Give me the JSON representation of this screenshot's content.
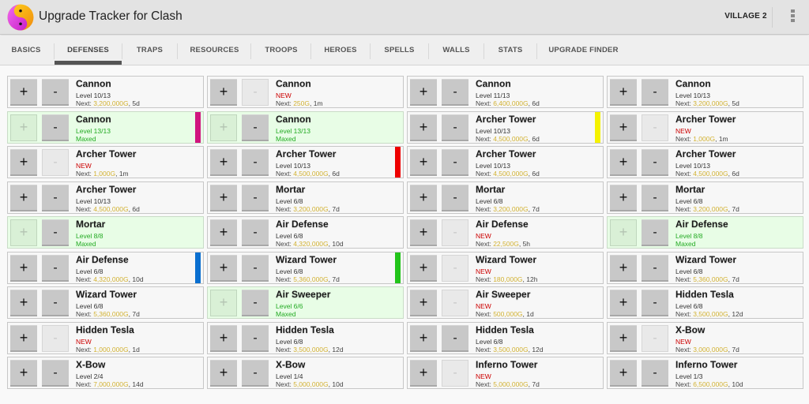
{
  "app": {
    "title": "Upgrade Tracker for Clash",
    "icon": "yin-yang-icon",
    "village_button": "VILLAGE 2",
    "overflow_icon": "overflow-menu-icon"
  },
  "tabs": [
    {
      "label": "BASICS",
      "active": false
    },
    {
      "label": "DEFENSES",
      "active": true
    },
    {
      "label": "TRAPS",
      "active": false
    },
    {
      "label": "RESOURCES",
      "active": false
    },
    {
      "label": "TROOPS",
      "active": false
    },
    {
      "label": "HEROES",
      "active": false
    },
    {
      "label": "SPELLS",
      "active": false
    },
    {
      "label": "WALLS",
      "active": false
    },
    {
      "label": "STATS",
      "active": false
    },
    {
      "label": "UPGRADE FINDER",
      "active": false
    }
  ],
  "labels": {
    "plus": "+",
    "minus": "-",
    "next_prefix": "Next: ",
    "sep": ", "
  },
  "columns": [
    [
      {
        "name": "Cannon",
        "status": "level",
        "level": "Level 10/13",
        "cost": "3,200,000G",
        "time": "5d",
        "plus_enabled": true,
        "minus_enabled": true,
        "marker": null
      },
      {
        "name": "Cannon",
        "status": "maxed",
        "level": "Level 13/13",
        "maxed": "Maxed",
        "plus_enabled": false,
        "minus_enabled": true,
        "marker": "#d0157e"
      },
      {
        "name": "Archer Tower",
        "status": "new",
        "level": "NEW",
        "cost": "1,000G",
        "time": "1m",
        "plus_enabled": true,
        "minus_enabled": false,
        "marker": null
      },
      {
        "name": "Archer Tower",
        "status": "level",
        "level": "Level 10/13",
        "cost": "4,500,000G",
        "time": "6d",
        "plus_enabled": true,
        "minus_enabled": true,
        "marker": null
      },
      {
        "name": "Mortar",
        "status": "maxed",
        "level": "Level 8/8",
        "maxed": "Maxed",
        "plus_enabled": false,
        "minus_enabled": true,
        "marker": null
      },
      {
        "name": "Air Defense",
        "status": "level",
        "level": "Level 6/8",
        "cost": "4,320,000G",
        "time": "10d",
        "plus_enabled": true,
        "minus_enabled": true,
        "marker": "#0a6fd0"
      },
      {
        "name": "Wizard Tower",
        "status": "level",
        "level": "Level 6/8",
        "cost": "5,360,000G",
        "time": "7d",
        "plus_enabled": true,
        "minus_enabled": true,
        "marker": null
      },
      {
        "name": "Hidden Tesla",
        "status": "new",
        "level": "NEW",
        "cost": "1,000,000G",
        "time": "1d",
        "plus_enabled": true,
        "minus_enabled": false,
        "marker": null
      },
      {
        "name": "X-Bow",
        "status": "level",
        "level": "Level 2/4",
        "cost": "7,000,000G",
        "time": "14d",
        "plus_enabled": true,
        "minus_enabled": true,
        "marker": null
      }
    ],
    [
      {
        "name": "Cannon",
        "status": "new",
        "level": "NEW",
        "cost": "250G",
        "time": "1m",
        "plus_enabled": true,
        "minus_enabled": false,
        "marker": null
      },
      {
        "name": "Cannon",
        "status": "maxed",
        "level": "Level 13/13",
        "maxed": "Maxed",
        "plus_enabled": false,
        "minus_enabled": true,
        "marker": null
      },
      {
        "name": "Archer Tower",
        "status": "level",
        "level": "Level 10/13",
        "cost": "4,500,000G",
        "time": "6d",
        "plus_enabled": true,
        "minus_enabled": true,
        "marker": "#ee0000"
      },
      {
        "name": "Mortar",
        "status": "level",
        "level": "Level 6/8",
        "cost": "3,200,000G",
        "time": "7d",
        "plus_enabled": true,
        "minus_enabled": true,
        "marker": null
      },
      {
        "name": "Air Defense",
        "status": "level",
        "level": "Level 6/8",
        "cost": "4,320,000G",
        "time": "10d",
        "plus_enabled": true,
        "minus_enabled": true,
        "marker": null
      },
      {
        "name": "Wizard Tower",
        "status": "level",
        "level": "Level 6/8",
        "cost": "5,360,000G",
        "time": "7d",
        "plus_enabled": true,
        "minus_enabled": true,
        "marker": "#22c41a"
      },
      {
        "name": "Air Sweeper",
        "status": "maxed",
        "level": "Level 6/6",
        "maxed": "Maxed",
        "plus_enabled": false,
        "minus_enabled": true,
        "marker": null
      },
      {
        "name": "Hidden Tesla",
        "status": "level",
        "level": "Level 6/8",
        "cost": "3,500,000G",
        "time": "12d",
        "plus_enabled": true,
        "minus_enabled": true,
        "marker": null
      },
      {
        "name": "X-Bow",
        "status": "level",
        "level": "Level 1/4",
        "cost": "5,000,000G",
        "time": "10d",
        "plus_enabled": true,
        "minus_enabled": true,
        "marker": null
      }
    ],
    [
      {
        "name": "Cannon",
        "status": "level",
        "level": "Level 11/13",
        "cost": "6,400,000G",
        "time": "6d",
        "plus_enabled": true,
        "minus_enabled": true,
        "marker": null
      },
      {
        "name": "Archer Tower",
        "status": "level",
        "level": "Level 10/13",
        "cost": "4,500,000G",
        "time": "6d",
        "plus_enabled": true,
        "minus_enabled": true,
        "marker": "#f5f200"
      },
      {
        "name": "Archer Tower",
        "status": "level",
        "level": "Level 10/13",
        "cost": "4,500,000G",
        "time": "6d",
        "plus_enabled": true,
        "minus_enabled": true,
        "marker": null
      },
      {
        "name": "Mortar",
        "status": "level",
        "level": "Level 6/8",
        "cost": "3,200,000G",
        "time": "7d",
        "plus_enabled": true,
        "minus_enabled": true,
        "marker": null
      },
      {
        "name": "Air Defense",
        "status": "new",
        "level": "NEW",
        "cost": "22,500G",
        "time": "5h",
        "plus_enabled": true,
        "minus_enabled": false,
        "marker": null
      },
      {
        "name": "Wizard Tower",
        "status": "new",
        "level": "NEW",
        "cost": "180,000G",
        "time": "12h",
        "plus_enabled": true,
        "minus_enabled": false,
        "marker": null
      },
      {
        "name": "Air Sweeper",
        "status": "new",
        "level": "NEW",
        "cost": "500,000G",
        "time": "1d",
        "plus_enabled": true,
        "minus_enabled": false,
        "marker": null
      },
      {
        "name": "Hidden Tesla",
        "status": "level",
        "level": "Level 6/8",
        "cost": "3,500,000G",
        "time": "12d",
        "plus_enabled": true,
        "minus_enabled": true,
        "marker": null
      },
      {
        "name": "Inferno Tower",
        "status": "new",
        "level": "NEW",
        "cost": "5,000,000G",
        "time": "7d",
        "plus_enabled": true,
        "minus_enabled": false,
        "marker": null
      }
    ],
    [
      {
        "name": "Cannon",
        "status": "level",
        "level": "Level 10/13",
        "cost": "3,200,000G",
        "time": "5d",
        "plus_enabled": true,
        "minus_enabled": true,
        "marker": null
      },
      {
        "name": "Archer Tower",
        "status": "new",
        "level": "NEW",
        "cost": "1,000G",
        "time": "1m",
        "plus_enabled": true,
        "minus_enabled": false,
        "marker": null
      },
      {
        "name": "Archer Tower",
        "status": "level",
        "level": "Level 10/13",
        "cost": "4,500,000G",
        "time": "6d",
        "plus_enabled": true,
        "minus_enabled": true,
        "marker": null
      },
      {
        "name": "Mortar",
        "status": "level",
        "level": "Level 6/8",
        "cost": "3,200,000G",
        "time": "7d",
        "plus_enabled": true,
        "minus_enabled": true,
        "marker": null
      },
      {
        "name": "Air Defense",
        "status": "maxed",
        "level": "Level 8/8",
        "maxed": "Maxed",
        "plus_enabled": false,
        "minus_enabled": true,
        "marker": null
      },
      {
        "name": "Wizard Tower",
        "status": "level",
        "level": "Level 6/8",
        "cost": "5,360,000G",
        "time": "7d",
        "plus_enabled": true,
        "minus_enabled": true,
        "marker": null
      },
      {
        "name": "Hidden Tesla",
        "status": "level",
        "level": "Level 6/8",
        "cost": "3,500,000G",
        "time": "12d",
        "plus_enabled": true,
        "minus_enabled": true,
        "marker": null
      },
      {
        "name": "X-Bow",
        "status": "new",
        "level": "NEW",
        "cost": "3,000,000G",
        "time": "7d",
        "plus_enabled": true,
        "minus_enabled": false,
        "marker": null
      },
      {
        "name": "Inferno Tower",
        "status": "level",
        "level": "Level 1/3",
        "cost": "6,500,000G",
        "time": "10d",
        "plus_enabled": true,
        "minus_enabled": true,
        "marker": null
      }
    ]
  ]
}
